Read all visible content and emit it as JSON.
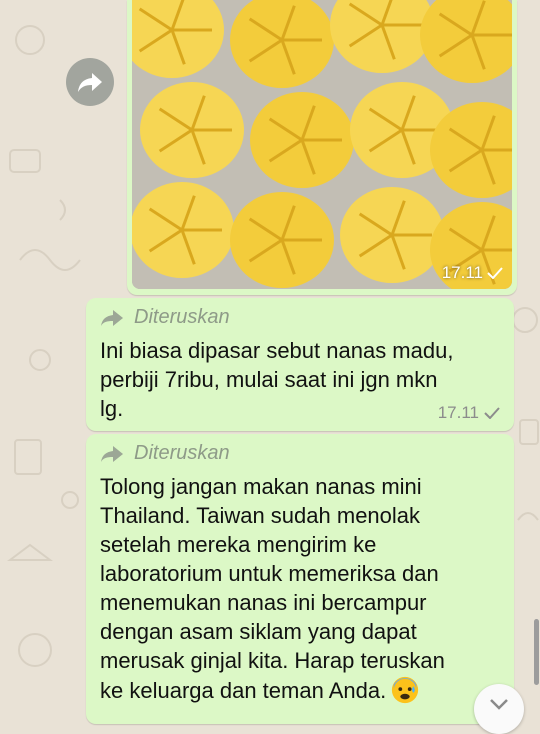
{
  "chat": {
    "messages": [
      {
        "type": "image",
        "time": "17.11",
        "status": "sent-check",
        "forward_button_icon": "forward-arrow-icon",
        "image_subject": "packaged peeled pineapples"
      },
      {
        "type": "text",
        "forwarded_label": "Diteruskan",
        "text": "Ini biasa dipasar sebut nanas madu,\nperbiji 7ribu, mulai saat ini jgn mkn\nlg.",
        "time": "17.11",
        "status": "sent-check"
      },
      {
        "type": "text",
        "forwarded_label": "Diteruskan",
        "text": "Tolong jangan makan nanas mini\nThailand.  Taiwan sudah menolak\nsetelah mereka mengirim ke\nlaboratorium untuk memeriksa dan\nmenemukan nanas ini bercampur\ndengan asam siklam yang dapat\nmerusak ginjal kita.  Harap teruskan\nke keluarga dan teman Anda.",
        "emoji": "anxious-face-with-sweat"
      }
    ]
  },
  "controls": {
    "scroll_down_icon": "chevron-down-icon"
  },
  "colors": {
    "wallpaper": "#e9e2d6",
    "outgoing_bubble": "#dcf8c6",
    "forward_label": "#8e9a88",
    "timestamp": "#8c8c8c"
  }
}
